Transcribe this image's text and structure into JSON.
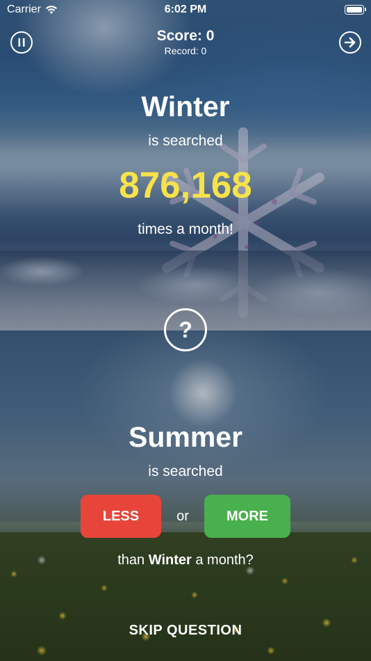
{
  "status_bar": {
    "carrier": "Carrier",
    "time": "6:02 PM"
  },
  "header": {
    "score_text": "Score: 0",
    "record_text": "Record: 0"
  },
  "known": {
    "term": "Winter",
    "searched_text": "is searched",
    "volume": "876,168",
    "suffix": "times a month!"
  },
  "question": {
    "symbol": "?"
  },
  "guess": {
    "term": "Summer",
    "searched_text": "is searched",
    "less_label": "LESS",
    "or_text": "or",
    "more_label": "MORE",
    "than_text": "than",
    "compare_term": "Winter",
    "month_text": "a month?"
  },
  "skip_label": "SKIP QUESTION",
  "colors": {
    "volume_yellow": "#f7e24a",
    "less_red": "#e8453a",
    "more_green": "#48b04c"
  },
  "icons": {
    "pause": "pause-icon",
    "next": "arrow-right-icon",
    "wifi": "wifi-icon",
    "battery": "battery-icon",
    "question": "question-icon"
  }
}
